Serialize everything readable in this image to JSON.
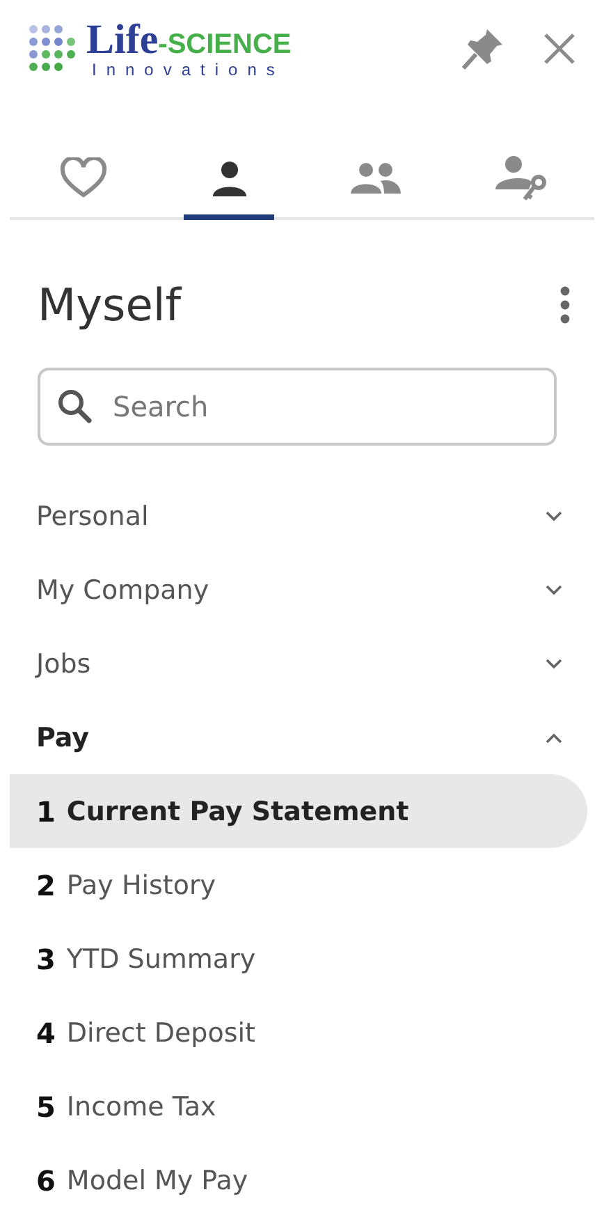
{
  "logo": {
    "word": "Life",
    "dash": "-SCIENCE",
    "sub": "Innovations"
  },
  "tabs": [
    {
      "kind": "heart",
      "selected": false
    },
    {
      "kind": "person",
      "selected": true
    },
    {
      "kind": "people",
      "selected": false
    },
    {
      "kind": "person-key",
      "selected": false
    }
  ],
  "title": "Myself",
  "search": {
    "placeholder": "Search"
  },
  "sections": [
    {
      "label": "Personal",
      "expanded": false
    },
    {
      "label": "My Company",
      "expanded": false
    },
    {
      "label": "Jobs",
      "expanded": false
    },
    {
      "label": "Pay",
      "expanded": true,
      "children": [
        {
          "number": "1",
          "label": "Current Pay Statement",
          "selected": true
        },
        {
          "number": "2",
          "label": "Pay History",
          "selected": false
        },
        {
          "number": "3",
          "label": "YTD Summary",
          "selected": false
        },
        {
          "number": "4",
          "label": "Direct Deposit",
          "selected": false
        },
        {
          "number": "5",
          "label": "Income Tax",
          "selected": false
        },
        {
          "number": "6",
          "label": "Model My Pay",
          "selected": false
        }
      ]
    }
  ]
}
